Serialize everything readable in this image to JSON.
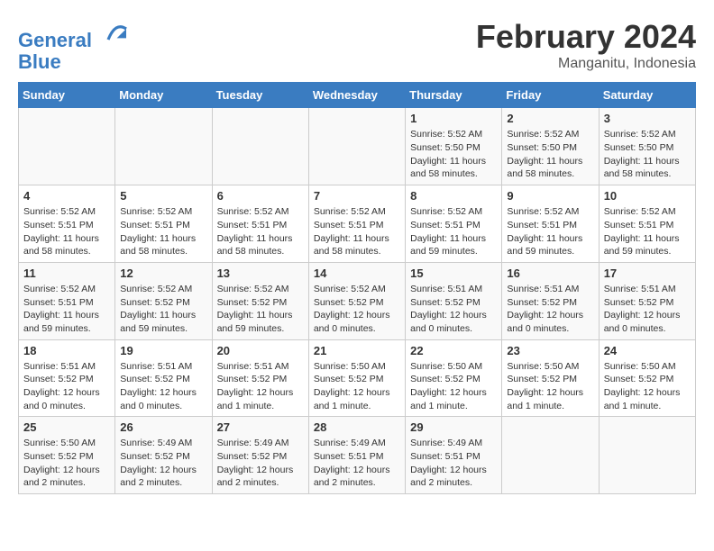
{
  "header": {
    "logo_line1": "General",
    "logo_line2": "Blue",
    "month_year": "February 2024",
    "location": "Manganitu, Indonesia"
  },
  "days_of_week": [
    "Sunday",
    "Monday",
    "Tuesday",
    "Wednesday",
    "Thursday",
    "Friday",
    "Saturday"
  ],
  "weeks": [
    [
      {
        "day": "",
        "info": ""
      },
      {
        "day": "",
        "info": ""
      },
      {
        "day": "",
        "info": ""
      },
      {
        "day": "",
        "info": ""
      },
      {
        "day": "1",
        "info": "Sunrise: 5:52 AM\nSunset: 5:50 PM\nDaylight: 11 hours\nand 58 minutes."
      },
      {
        "day": "2",
        "info": "Sunrise: 5:52 AM\nSunset: 5:50 PM\nDaylight: 11 hours\nand 58 minutes."
      },
      {
        "day": "3",
        "info": "Sunrise: 5:52 AM\nSunset: 5:50 PM\nDaylight: 11 hours\nand 58 minutes."
      }
    ],
    [
      {
        "day": "4",
        "info": "Sunrise: 5:52 AM\nSunset: 5:51 PM\nDaylight: 11 hours\nand 58 minutes."
      },
      {
        "day": "5",
        "info": "Sunrise: 5:52 AM\nSunset: 5:51 PM\nDaylight: 11 hours\nand 58 minutes."
      },
      {
        "day": "6",
        "info": "Sunrise: 5:52 AM\nSunset: 5:51 PM\nDaylight: 11 hours\nand 58 minutes."
      },
      {
        "day": "7",
        "info": "Sunrise: 5:52 AM\nSunset: 5:51 PM\nDaylight: 11 hours\nand 58 minutes."
      },
      {
        "day": "8",
        "info": "Sunrise: 5:52 AM\nSunset: 5:51 PM\nDaylight: 11 hours\nand 59 minutes."
      },
      {
        "day": "9",
        "info": "Sunrise: 5:52 AM\nSunset: 5:51 PM\nDaylight: 11 hours\nand 59 minutes."
      },
      {
        "day": "10",
        "info": "Sunrise: 5:52 AM\nSunset: 5:51 PM\nDaylight: 11 hours\nand 59 minutes."
      }
    ],
    [
      {
        "day": "11",
        "info": "Sunrise: 5:52 AM\nSunset: 5:51 PM\nDaylight: 11 hours\nand 59 minutes."
      },
      {
        "day": "12",
        "info": "Sunrise: 5:52 AM\nSunset: 5:52 PM\nDaylight: 11 hours\nand 59 minutes."
      },
      {
        "day": "13",
        "info": "Sunrise: 5:52 AM\nSunset: 5:52 PM\nDaylight: 11 hours\nand 59 minutes."
      },
      {
        "day": "14",
        "info": "Sunrise: 5:52 AM\nSunset: 5:52 PM\nDaylight: 12 hours\nand 0 minutes."
      },
      {
        "day": "15",
        "info": "Sunrise: 5:51 AM\nSunset: 5:52 PM\nDaylight: 12 hours\nand 0 minutes."
      },
      {
        "day": "16",
        "info": "Sunrise: 5:51 AM\nSunset: 5:52 PM\nDaylight: 12 hours\nand 0 minutes."
      },
      {
        "day": "17",
        "info": "Sunrise: 5:51 AM\nSunset: 5:52 PM\nDaylight: 12 hours\nand 0 minutes."
      }
    ],
    [
      {
        "day": "18",
        "info": "Sunrise: 5:51 AM\nSunset: 5:52 PM\nDaylight: 12 hours\nand 0 minutes."
      },
      {
        "day": "19",
        "info": "Sunrise: 5:51 AM\nSunset: 5:52 PM\nDaylight: 12 hours\nand 0 minutes."
      },
      {
        "day": "20",
        "info": "Sunrise: 5:51 AM\nSunset: 5:52 PM\nDaylight: 12 hours\nand 1 minute."
      },
      {
        "day": "21",
        "info": "Sunrise: 5:50 AM\nSunset: 5:52 PM\nDaylight: 12 hours\nand 1 minute."
      },
      {
        "day": "22",
        "info": "Sunrise: 5:50 AM\nSunset: 5:52 PM\nDaylight: 12 hours\nand 1 minute."
      },
      {
        "day": "23",
        "info": "Sunrise: 5:50 AM\nSunset: 5:52 PM\nDaylight: 12 hours\nand 1 minute."
      },
      {
        "day": "24",
        "info": "Sunrise: 5:50 AM\nSunset: 5:52 PM\nDaylight: 12 hours\nand 1 minute."
      }
    ],
    [
      {
        "day": "25",
        "info": "Sunrise: 5:50 AM\nSunset: 5:52 PM\nDaylight: 12 hours\nand 2 minutes."
      },
      {
        "day": "26",
        "info": "Sunrise: 5:49 AM\nSunset: 5:52 PM\nDaylight: 12 hours\nand 2 minutes."
      },
      {
        "day": "27",
        "info": "Sunrise: 5:49 AM\nSunset: 5:52 PM\nDaylight: 12 hours\nand 2 minutes."
      },
      {
        "day": "28",
        "info": "Sunrise: 5:49 AM\nSunset: 5:51 PM\nDaylight: 12 hours\nand 2 minutes."
      },
      {
        "day": "29",
        "info": "Sunrise: 5:49 AM\nSunset: 5:51 PM\nDaylight: 12 hours\nand 2 minutes."
      },
      {
        "day": "",
        "info": ""
      },
      {
        "day": "",
        "info": ""
      }
    ]
  ]
}
